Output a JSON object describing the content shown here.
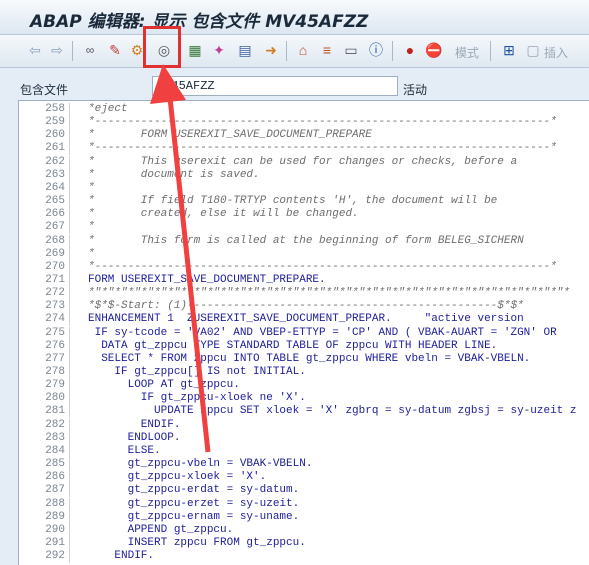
{
  "window": {
    "title": "ABAP 编辑器: 显示 包含文件 MV45AFZZ"
  },
  "toolbar": {
    "mode_label": "模式",
    "insert_label": "插入",
    "icons": [
      "back-icon",
      "forward-icon",
      "glasses-icon",
      "pattern-icon",
      "where-used-icon",
      "spiral-icon",
      "object-list-icon",
      "magic-wand-icon",
      "print-icon",
      "export-icon",
      "hierarchy-icon",
      "stack-icon",
      "table-icon",
      "info-icon",
      "breakpoint-icon",
      "stop-icon",
      "insert-icon"
    ]
  },
  "info": {
    "label": "包含文件",
    "value": "MV45AFZZ",
    "status": "活动"
  },
  "colors": {
    "highlight": "#e03030",
    "arrow": "#f04040"
  },
  "editor": {
    "lines": [
      {
        "num": "258",
        "text": "*eject",
        "type": "comment"
      },
      {
        "num": "259",
        "text": "*---------------------------------------------------------------------*",
        "type": "comment"
      },
      {
        "num": "260",
        "text": "*       FORM USEREXIT_SAVE_DOCUMENT_PREPARE",
        "type": "comment"
      },
      {
        "num": "261",
        "text": "*---------------------------------------------------------------------*",
        "type": "comment"
      },
      {
        "num": "262",
        "text": "*       This userexit can be used for changes or checks, before a",
        "type": "comment"
      },
      {
        "num": "263",
        "text": "*       document is saved.",
        "type": "comment"
      },
      {
        "num": "264",
        "text": "*",
        "type": "comment"
      },
      {
        "num": "265",
        "text": "*       If field T180-TRTYP contents 'H', the document will be",
        "type": "comment"
      },
      {
        "num": "266",
        "text": "*       created, else it will be changed.",
        "type": "comment"
      },
      {
        "num": "267",
        "text": "*",
        "type": "comment"
      },
      {
        "num": "268",
        "text": "*       This form is called at the beginning of form BELEG_SICHERN",
        "type": "comment"
      },
      {
        "num": "269",
        "text": "*",
        "type": "comment"
      },
      {
        "num": "270",
        "text": "*---------------------------------------------------------------------*",
        "type": "comment"
      },
      {
        "num": "271",
        "text": "FORM USEREXIT_SAVE_DOCUMENT_PREPARE.",
        "type": "code"
      },
      {
        "num": "272",
        "text": "*\"*\"*\"*\"*\"*\"*\"*\"*\"*\"*\"*\"*\"*\"*\"*\"*\"*\"*\"*\"*\"*\"*\"*\"*\"*\"*\"*\"*\"*\"*\"*\"*\"*\"*\"*\"*",
        "type": "comment"
      },
      {
        "num": "273",
        "text": "*$*$-Start: (1)-----------------------------------------------$*$*",
        "type": "comment"
      },
      {
        "num": "274",
        "text": "ENHANCEMENT 1  ZUSEREXIT_SAVE_DOCUMENT_PREPAR.     \"active version",
        "type": "code"
      },
      {
        "num": "275",
        "text": " IF sy-tcode = 'VA02' AND VBEP-ETTYP = 'CP' AND ( VBAK-AUART = 'ZGN' OR",
        "type": "code"
      },
      {
        "num": "276",
        "text": "  DATA gt_zppcu TYPE STANDARD TABLE OF zppcu WITH HEADER LINE.",
        "type": "code"
      },
      {
        "num": "277",
        "text": "  SELECT * FROM zppcu INTO TABLE gt_zppcu WHERE vbeln = VBAK-VBELN.",
        "type": "code"
      },
      {
        "num": "278",
        "text": "    IF gt_zppcu[] IS not INITIAL.",
        "type": "code"
      },
      {
        "num": "279",
        "text": "      LOOP AT gt_zppcu.",
        "type": "code"
      },
      {
        "num": "280",
        "text": "        IF gt_zppcu-xloek ne 'X'.",
        "type": "code"
      },
      {
        "num": "281",
        "text": "          UPDATE zppcu SET xloek = 'X' zgbrq = sy-datum zgbsj = sy-uzeit z",
        "type": "code"
      },
      {
        "num": "282",
        "text": "        ENDIF.",
        "type": "code"
      },
      {
        "num": "283",
        "text": "      ENDLOOP.",
        "type": "code"
      },
      {
        "num": "284",
        "text": "      ELSE.",
        "type": "code"
      },
      {
        "num": "285",
        "text": "      gt_zppcu-vbeln = VBAK-VBELN.",
        "type": "code"
      },
      {
        "num": "286",
        "text": "      gt_zppcu-xloek = 'X'.",
        "type": "code"
      },
      {
        "num": "287",
        "text": "      gt_zppcu-erdat = sy-datum.",
        "type": "code"
      },
      {
        "num": "288",
        "text": "      gt_zppcu-erzet = sy-uzeit.",
        "type": "code"
      },
      {
        "num": "289",
        "text": "      gt_zppcu-ernam = sy-uname.",
        "type": "code"
      },
      {
        "num": "290",
        "text": "      APPEND gt_zppcu.",
        "type": "code"
      },
      {
        "num": "291",
        "text": "      INSERT zppcu FROM gt_zppcu.",
        "type": "code"
      },
      {
        "num": "292",
        "text": "    ENDIF.",
        "type": "code"
      }
    ]
  }
}
